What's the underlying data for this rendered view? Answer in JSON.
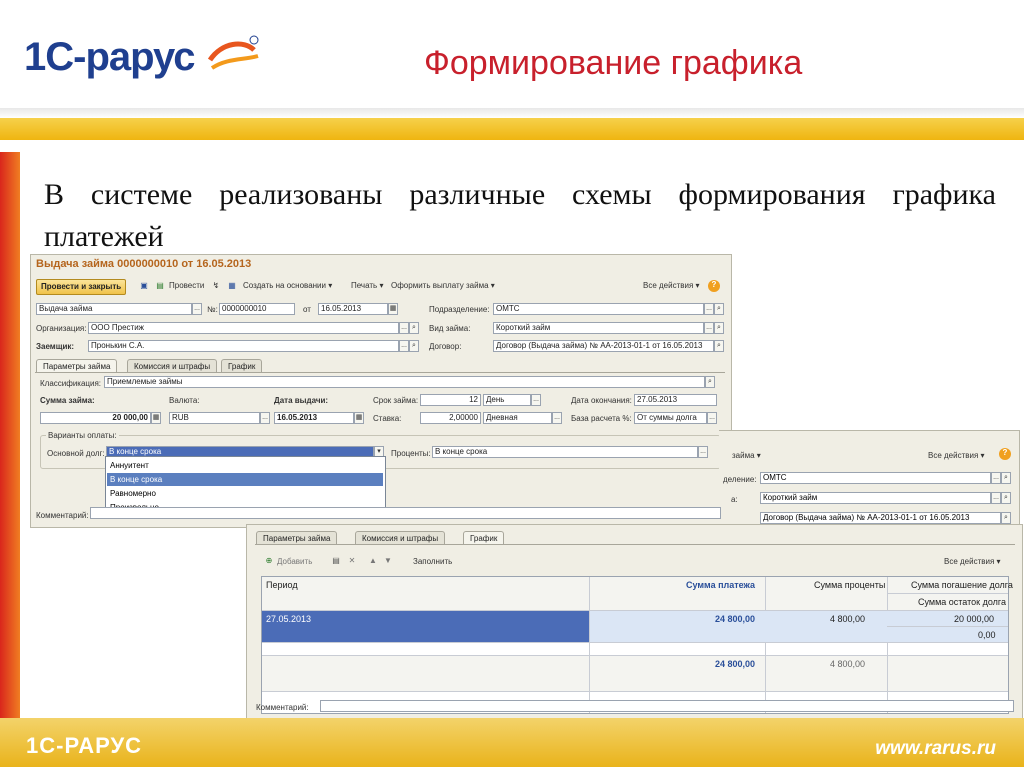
{
  "slide": {
    "title": "Формирование графика",
    "body": "В системе реализованы различные схемы формирования графика платежей",
    "footer_logo": "1С-РАРУС",
    "footer_url": "www.rarus.ru",
    "logo_text": "1С-рарус",
    "colors": {
      "title": "#c8202c",
      "band": "#efb510",
      "stripe": "#d9261c"
    }
  },
  "form1": {
    "title": "Выдача займа 0000000010 от 16.05.2013",
    "toolbar": {
      "post_close": "Провести и закрыть",
      "post": "Провести",
      "create_based": "Создать на основании",
      "print": "Печать",
      "pay": "Оформить выплату займа",
      "all_actions": "Все действия",
      "help": "?"
    },
    "doc_type": "Выдача займа",
    "number_label": "№:",
    "number": "0000000010",
    "date_label": "от",
    "date": "16.05.2013",
    "subdivision_label": "Подразделение:",
    "subdivision": "ОМТС",
    "org_label": "Организация:",
    "org": "ООО Престиж",
    "loan_type_label": "Вид займа:",
    "loan_type": "Короткий займ",
    "borrower_label": "Заемщик:",
    "borrower": "Пронькин С.А.",
    "contract_label": "Договор:",
    "contract": "Договор (Выдача займа) № АА-2013-01-1 от 16.05.2013",
    "tabs": [
      "Параметры займа",
      "Комиссия и штрафы",
      "График"
    ],
    "class_label": "Классификация:",
    "class_value": "Приемлемые займы",
    "amount_label": "Сумма займа:",
    "amount": "20 000,00",
    "currency_label": "Валюта:",
    "currency": "RUB",
    "issue_date_label": "Дата выдачи:",
    "issue_date": "16.05.2013",
    "term_label": "Срок займа:",
    "term": "12",
    "term_unit": "День",
    "end_date_label": "Дата окончания:",
    "end_date": "27.05.2013",
    "rate_label": "Ставка:",
    "rate": "2,00000",
    "rate_type": "Дневная",
    "base_label": "База расчета %:",
    "base": "От суммы долга",
    "payment_group_label": "Варианты оплаты:",
    "main_debt_label": "Основной долг:",
    "main_debt": "В конце срока",
    "interest_label": "Проценты:",
    "interest": "В конце срока",
    "dropdown_options": [
      "Аннуитент",
      "В конце срока",
      "Равномерно",
      "Произвольно"
    ],
    "comment_label": "Комментарий:"
  },
  "form2": {
    "toolbar_tail": "займа",
    "all_actions": "Все действия",
    "subdivision_label": "деление:",
    "subdivision": "ОМТС",
    "loan_type_label": "а:",
    "loan_type": "Короткий займ",
    "contract": "Договор (Выдача займа) № АА-2013-01-1 от 16.05.2013"
  },
  "form3": {
    "tabs": [
      "Параметры займа",
      "Комиссия и штрафы",
      "График"
    ],
    "toolbar": {
      "add": "Добавить",
      "fill": "Заполнить",
      "all_actions": "Все действия"
    },
    "columns": {
      "period": "Период",
      "payment": "Сумма платежа",
      "interest": "Сумма проценты",
      "debt_repay": "Сумма погашение долга",
      "debt_rest": "Сумма остаток долга"
    },
    "rows": [
      {
        "period": "27.05.2013",
        "payment": "24 800,00",
        "interest": "4 800,00",
        "debt_repay": "20 000,00",
        "debt_rest": "0,00"
      }
    ],
    "totals": {
      "payment": "24 800,00",
      "interest": "4 800,00"
    },
    "comment_label": "Комментарий:"
  }
}
